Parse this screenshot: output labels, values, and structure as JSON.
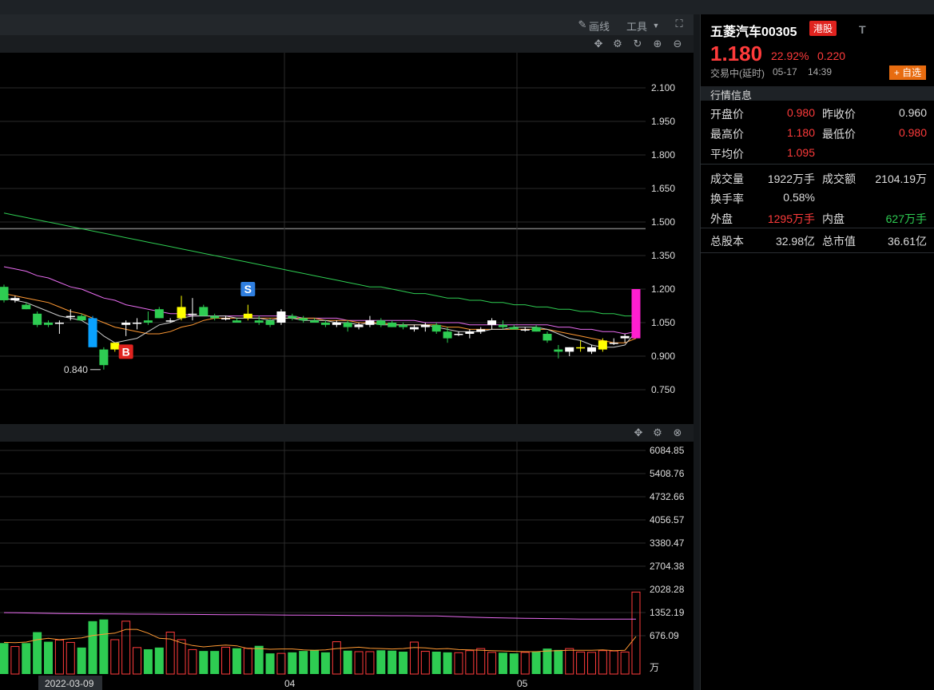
{
  "toolbar": {
    "draw_label": "画线",
    "tools_label": "工具"
  },
  "icons": [
    "pencil-icon",
    "chevron-down-icon",
    "fullscreen-icon",
    "move-icon",
    "gear-icon",
    "refresh-icon",
    "zoom-in-icon",
    "zoom-out-icon",
    "close-icon"
  ],
  "stock": {
    "name": "五菱汽车00305",
    "market_badge": "港股",
    "t_label": "T",
    "price": "1.180",
    "change_pct": "22.92%",
    "change": "0.220",
    "status": "交易中(延时)",
    "date": "05-17",
    "time": "14:39",
    "add_watchlist": "+ 自选"
  },
  "quote": {
    "section_title": "行情信息",
    "open_label": "开盘价",
    "open": "0.980",
    "prev_close_label": "昨收价",
    "prev_close": "0.960",
    "high_label": "最高价",
    "high": "1.180",
    "low_label": "最低价",
    "low": "0.980",
    "avg_label": "平均价",
    "avg": "1.095",
    "volume_label": "成交量",
    "volume": "1922万手",
    "turnover_label": "成交额",
    "turnover": "2104.19万",
    "turnover_rate_label": "换手率",
    "turnover_rate": "0.58%",
    "outer_label": "外盘",
    "outer": "1295万手",
    "inner_label": "内盘",
    "inner": "627万手",
    "total_shares_label": "总股本",
    "total_shares": "32.98亿",
    "market_cap_label": "总市值",
    "market_cap": "36.61亿"
  },
  "colors": {
    "up": "#ff3b3b",
    "down": "#2ecc52",
    "accent": "#e86c10",
    "ma5": "#ffffff",
    "ma10": "#ff9933",
    "ma20": "#e86cf0",
    "ma60": "#2ecc52"
  },
  "chart_data": [
    {
      "type": "candlestick",
      "y_ticks": [
        "2.100",
        "1.950",
        "1.800",
        "1.650",
        "1.500",
        "1.350",
        "1.200",
        "1.050",
        "0.900",
        "0.750"
      ],
      "ylim": [
        0.63,
        2.22
      ],
      "x_ticks": [
        "2022-03-09",
        "04",
        "05"
      ],
      "min_annotation": "0.840",
      "markers": [
        "S",
        "B"
      ],
      "ohlc": [
        [
          1.21,
          1.22,
          1.14,
          1.15
        ],
        [
          1.15,
          1.17,
          1.14,
          1.16
        ],
        [
          1.13,
          1.14,
          1.11,
          1.11
        ],
        [
          1.09,
          1.1,
          1.03,
          1.04
        ],
        [
          1.05,
          1.06,
          1.03,
          1.04
        ],
        [
          1.05,
          1.06,
          1.0,
          1.05
        ],
        [
          1.08,
          1.11,
          1.06,
          1.08
        ],
        [
          1.08,
          1.09,
          1.06,
          1.06
        ],
        [
          1.07,
          1.08,
          0.94,
          0.94
        ],
        [
          0.93,
          0.94,
          0.84,
          0.86
        ],
        [
          0.93,
          0.96,
          0.92,
          0.96
        ],
        [
          1.04,
          1.06,
          0.99,
          1.05
        ],
        [
          1.05,
          1.07,
          1.02,
          1.05
        ],
        [
          1.06,
          1.1,
          1.04,
          1.05
        ],
        [
          1.11,
          1.12,
          1.07,
          1.07
        ],
        [
          1.06,
          1.07,
          1.05,
          1.06
        ],
        [
          1.07,
          1.17,
          1.06,
          1.12
        ],
        [
          1.09,
          1.16,
          1.06,
          1.09
        ],
        [
          1.12,
          1.13,
          1.08,
          1.08
        ],
        [
          1.08,
          1.09,
          1.06,
          1.07
        ],
        [
          1.07,
          1.08,
          1.06,
          1.07
        ],
        [
          1.06,
          1.07,
          1.05,
          1.05
        ],
        [
          1.07,
          1.13,
          1.06,
          1.09
        ],
        [
          1.06,
          1.08,
          1.04,
          1.05
        ],
        [
          1.06,
          1.07,
          1.03,
          1.04
        ],
        [
          1.05,
          1.11,
          1.04,
          1.1
        ],
        [
          1.08,
          1.09,
          1.06,
          1.07
        ],
        [
          1.07,
          1.08,
          1.05,
          1.06
        ],
        [
          1.06,
          1.07,
          1.05,
          1.05
        ],
        [
          1.05,
          1.06,
          1.03,
          1.04
        ],
        [
          1.04,
          1.06,
          1.03,
          1.05
        ],
        [
          1.05,
          1.06,
          1.01,
          1.03
        ],
        [
          1.03,
          1.05,
          1.02,
          1.04
        ],
        [
          1.04,
          1.08,
          1.03,
          1.06
        ],
        [
          1.06,
          1.07,
          1.03,
          1.04
        ],
        [
          1.05,
          1.06,
          1.03,
          1.03
        ],
        [
          1.04,
          1.05,
          1.02,
          1.03
        ],
        [
          1.02,
          1.04,
          1.01,
          1.03
        ],
        [
          1.03,
          1.05,
          1.01,
          1.04
        ],
        [
          1.04,
          1.05,
          1.0,
          1.01
        ],
        [
          1.01,
          1.03,
          0.96,
          0.98
        ],
        [
          1.0,
          1.01,
          0.99,
          1.0
        ],
        [
          1.0,
          1.02,
          0.98,
          1.01
        ],
        [
          1.01,
          1.03,
          1.0,
          1.02
        ],
        [
          1.04,
          1.07,
          1.02,
          1.06
        ],
        [
          1.04,
          1.06,
          1.02,
          1.03
        ],
        [
          1.03,
          1.04,
          1.02,
          1.02
        ],
        [
          1.02,
          1.03,
          1.01,
          1.02
        ],
        [
          1.03,
          1.04,
          1.01,
          1.01
        ],
        [
          1.0,
          1.01,
          0.96,
          0.97
        ],
        [
          0.93,
          0.95,
          0.89,
          0.92
        ],
        [
          0.92,
          0.94,
          0.9,
          0.94
        ],
        [
          0.94,
          0.97,
          0.92,
          0.94
        ],
        [
          0.92,
          0.95,
          0.91,
          0.94
        ],
        [
          0.93,
          0.98,
          0.92,
          0.97
        ],
        [
          0.96,
          0.98,
          0.95,
          0.96
        ],
        [
          0.98,
          1.0,
          0.96,
          0.99
        ],
        [
          0.98,
          1.2,
          0.98,
          1.2
        ]
      ],
      "ma5": [
        1.16,
        1.15,
        1.14,
        1.12,
        1.1,
        1.08,
        1.07,
        1.06,
        1.03,
        0.99,
        0.96,
        0.97,
        0.98,
        1.01,
        1.04,
        1.05,
        1.07,
        1.08,
        1.08,
        1.08,
        1.08,
        1.07,
        1.07,
        1.07,
        1.06,
        1.07,
        1.07,
        1.06,
        1.06,
        1.06,
        1.05,
        1.05,
        1.04,
        1.05,
        1.04,
        1.04,
        1.04,
        1.04,
        1.04,
        1.03,
        1.02,
        1.01,
        1.01,
        1.01,
        1.02,
        1.02,
        1.03,
        1.03,
        1.03,
        1.02,
        1.0,
        0.98,
        0.97,
        0.95,
        0.94,
        0.94,
        0.95,
        1.01
      ],
      "ma10": [
        1.18,
        1.17,
        1.16,
        1.15,
        1.14,
        1.12,
        1.1,
        1.09,
        1.07,
        1.05,
        1.03,
        1.02,
        1.01,
        1.0,
        1.0,
        1.01,
        1.03,
        1.04,
        1.06,
        1.07,
        1.07,
        1.07,
        1.07,
        1.07,
        1.07,
        1.07,
        1.07,
        1.07,
        1.07,
        1.06,
        1.06,
        1.06,
        1.05,
        1.05,
        1.05,
        1.04,
        1.04,
        1.04,
        1.04,
        1.04,
        1.03,
        1.03,
        1.02,
        1.02,
        1.02,
        1.02,
        1.02,
        1.02,
        1.02,
        1.02,
        1.01,
        1.0,
        0.99,
        0.98,
        0.97,
        0.96,
        0.96,
        0.98
      ],
      "ma20": [
        1.3,
        1.29,
        1.28,
        1.26,
        1.25,
        1.23,
        1.21,
        1.2,
        1.18,
        1.16,
        1.15,
        1.13,
        1.12,
        1.11,
        1.1,
        1.09,
        1.09,
        1.08,
        1.08,
        1.08,
        1.08,
        1.08,
        1.08,
        1.08,
        1.08,
        1.08,
        1.08,
        1.07,
        1.07,
        1.07,
        1.07,
        1.06,
        1.06,
        1.06,
        1.06,
        1.06,
        1.06,
        1.06,
        1.05,
        1.05,
        1.05,
        1.05,
        1.04,
        1.04,
        1.04,
        1.04,
        1.04,
        1.04,
        1.04,
        1.04,
        1.03,
        1.03,
        1.02,
        1.02,
        1.01,
        1.01,
        1.0,
        1.01
      ],
      "ma60": [
        1.54,
        1.53,
        1.52,
        1.51,
        1.5,
        1.49,
        1.48,
        1.47,
        1.46,
        1.45,
        1.44,
        1.43,
        1.42,
        1.41,
        1.4,
        1.39,
        1.38,
        1.37,
        1.36,
        1.35,
        1.34,
        1.33,
        1.32,
        1.31,
        1.3,
        1.29,
        1.28,
        1.27,
        1.26,
        1.25,
        1.24,
        1.23,
        1.22,
        1.21,
        1.21,
        1.2,
        1.19,
        1.18,
        1.18,
        1.17,
        1.16,
        1.16,
        1.15,
        1.15,
        1.14,
        1.14,
        1.13,
        1.13,
        1.12,
        1.12,
        1.11,
        1.11,
        1.1,
        1.1,
        1.09,
        1.09,
        1.08,
        1.08
      ]
    },
    {
      "type": "bar",
      "y_ticks": [
        "6084.85",
        "5408.76",
        "4732.66",
        "4056.57",
        "3380.47",
        "2704.38",
        "2028.28",
        "1352.19",
        "676.09"
      ],
      "unit": "万",
      "ylim": [
        0,
        6760
      ],
      "volume": [
        460,
        360,
        460,
        780,
        500,
        550,
        480,
        330,
        1100,
        1150,
        560,
        1100,
        330,
        280,
        330,
        780,
        560,
        270,
        230,
        230,
        340,
        310,
        310,
        380,
        160,
        160,
        190,
        230,
        260,
        190,
        500,
        240,
        210,
        210,
        250,
        240,
        210,
        490,
        220,
        210,
        190,
        180,
        240,
        300,
        190,
        180,
        160,
        190,
        210,
        300,
        260,
        300,
        200,
        190,
        240,
        230,
        200,
        1950
      ],
      "vol_ma": [
        1350,
        1345,
        1340,
        1335,
        1330,
        1325,
        1320,
        1318,
        1315,
        1312,
        1310,
        1308,
        1306,
        1305,
        1303,
        1300,
        1298,
        1296,
        1294,
        1292,
        1290,
        1288,
        1286,
        1284,
        1282,
        1280,
        1278,
        1276,
        1274,
        1272,
        1270,
        1268,
        1266,
        1264,
        1262,
        1260,
        1258,
        1256,
        1254,
        1252,
        1240,
        1230,
        1220,
        1210,
        1200,
        1195,
        1190,
        1185,
        1180,
        1175,
        1170,
        1165,
        1160,
        1160,
        1160,
        1160,
        1160,
        1160
      ],
      "vol_ma5": [
        480,
        470,
        490,
        560,
        600,
        560,
        590,
        610,
        680,
        720,
        750,
        860,
        860,
        750,
        600,
        580,
        470,
        390,
        350,
        380,
        400,
        380,
        300,
        300,
        280,
        290,
        290,
        260,
        250,
        260,
        300,
        320,
        340,
        310,
        300,
        290,
        300,
        330,
        320,
        290,
        300,
        270,
        260,
        250,
        240,
        230,
        220,
        210,
        210,
        230,
        240,
        250,
        250,
        250,
        260,
        240,
        250,
        650
      ]
    }
  ]
}
